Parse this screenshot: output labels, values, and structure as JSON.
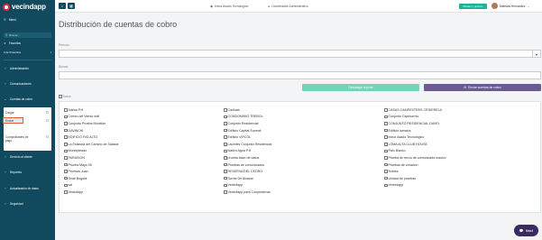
{
  "app": {
    "logo": "vecindapp"
  },
  "sidebar": {
    "menu": "Menú",
    "search_placeholder": "Buscar...",
    "favorites": "Favoritos",
    "favorites_count": "0 de 5 favoritos",
    "items": [
      {
        "label": "Administración"
      },
      {
        "label": "Comunicaciones"
      },
      {
        "label": "Cuentas de cobro"
      }
    ],
    "submenu": {
      "items": [
        "Cargar",
        "Enviar",
        "Comprobantes de pago"
      ]
    },
    "items_after": [
      {
        "label": "Servicio al cliente"
      },
      {
        "label": "Reportes"
      },
      {
        "label": "Actualización de datos"
      },
      {
        "label": "Seguridad"
      }
    ]
  },
  "topbar": {
    "links": [
      "Inbox Asado Tecnológico",
      "Coordinador Administrativo"
    ],
    "pill": "Planes y precios",
    "user": "Matthias Hernandez"
  },
  "main": {
    "title": "Distribución de cuentas de cobro",
    "periodo_label": "Periodo",
    "buscar_label": "Buscar",
    "btn_reporte": "Descargar reporte",
    "btn_enviar": "Enviar cuentas de cobro",
    "todos": "Todos",
    "columns": [
      [
        "Adesa P.H",
        "Correo del Viento edit",
        "Conjunto Prueba Modelón",
        "DAVINCHI",
        "EDIFICIO RIO ALTO",
        "La Estancia del Camino de Salazar",
        "Montepinado",
        "PARAISON",
        "Prueba Mayo 05",
        "Pruebas Juan",
        "Sede Bogotá",
        "sai",
        "Vecindapp"
      ],
      [
        "Carikark",
        "CONDOMINIO TREBOL",
        "Conjunto Residencial",
        "Edificio Capital Summit",
        "Edificio VIPCOL",
        "Laureles Conjunto Residencial",
        "Nativo Agua P.H",
        "prueba base de datos",
        "Pruebas de comunicados",
        "RESERVA DEL CEDRO",
        "Torres De Alcazar",
        "Vecindapp",
        "Vecindapp para Cooperativas"
      ],
      [
        "CASAS CAMPESTRES CRIDERELA",
        "Conjunto Capricornio",
        "CONJUNTO RESIDENCIAL DAVID",
        "Edificio lamaica",
        "Inbox Asado Tecnológico",
        "LOMA ALTA CLUB HOUSE",
        "Palo Blanco",
        "Prueba de envío de comunicado masivo",
        "Pruebas de creación",
        "Robles",
        "Unidad de pruebas",
        "Vecindapp"
      ]
    ]
  },
  "chat": {
    "label": "Vec!"
  },
  "colors": {
    "sidebar": "#114a5e",
    "accent": "#e0293f",
    "green": "#78d2b5",
    "purple": "#6b5b95"
  }
}
